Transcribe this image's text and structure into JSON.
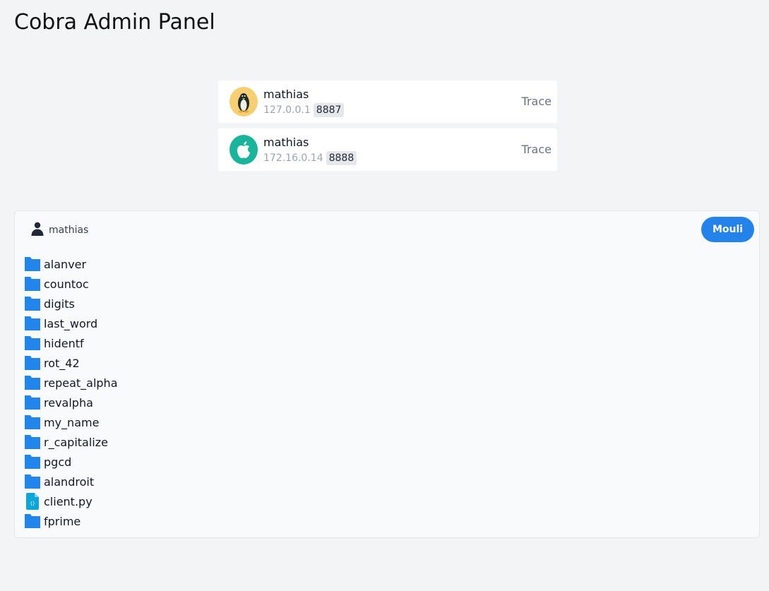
{
  "header": {
    "title": "Cobra Admin Panel"
  },
  "clients": [
    {
      "os_icon": "linux-tux-icon",
      "avatar_color": "#f6cf73",
      "username": "mathias",
      "ip": "127.0.0.1",
      "port": "8887",
      "action_label": "Trace"
    },
    {
      "os_icon": "apple-icon",
      "avatar_color": "#1ab49a",
      "username": "mathias",
      "ip": "172.16.0.14",
      "port": "8888",
      "action_label": "Trace"
    }
  ],
  "explorer": {
    "user_icon": "user-icon",
    "username": "mathias",
    "mouli_label": "Mouli",
    "accent_color": "#2383ea",
    "items": [
      {
        "name": "alanver",
        "type": "folder",
        "icon": "folder-icon"
      },
      {
        "name": "countoc",
        "type": "folder",
        "icon": "folder-icon"
      },
      {
        "name": "digits",
        "type": "folder",
        "icon": "folder-icon"
      },
      {
        "name": "last_word",
        "type": "folder",
        "icon": "folder-icon"
      },
      {
        "name": "hidentf",
        "type": "folder",
        "icon": "folder-icon"
      },
      {
        "name": "rot_42",
        "type": "folder",
        "icon": "folder-icon"
      },
      {
        "name": "repeat_alpha",
        "type": "folder",
        "icon": "folder-icon"
      },
      {
        "name": "revalpha",
        "type": "folder",
        "icon": "folder-icon"
      },
      {
        "name": "my_name",
        "type": "folder",
        "icon": "folder-icon"
      },
      {
        "name": "r_capitalize",
        "type": "folder",
        "icon": "folder-icon"
      },
      {
        "name": "pgcd",
        "type": "folder",
        "icon": "folder-icon"
      },
      {
        "name": "alandroit",
        "type": "folder",
        "icon": "folder-icon"
      },
      {
        "name": "client.py",
        "type": "file",
        "icon": "code-file-icon"
      },
      {
        "name": "fprime",
        "type": "folder",
        "icon": "folder-icon"
      }
    ]
  }
}
